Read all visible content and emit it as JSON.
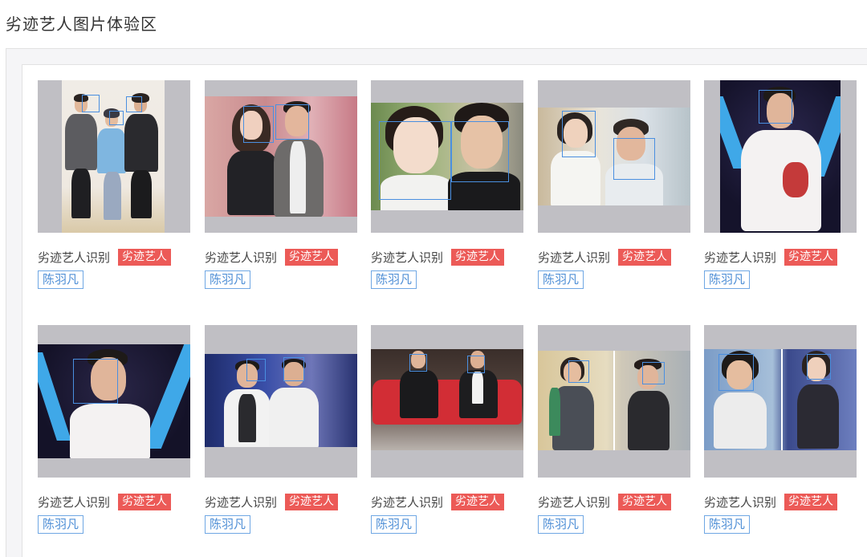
{
  "page": {
    "title": "劣迹艺人图片体验区"
  },
  "cards": [
    {
      "category": "劣迹艺人识别",
      "tag": "劣迹艺人",
      "name": "陈羽凡"
    },
    {
      "category": "劣迹艺人识别",
      "tag": "劣迹艺人",
      "name": "陈羽凡"
    },
    {
      "category": "劣迹艺人识别",
      "tag": "劣迹艺人",
      "name": "陈羽凡"
    },
    {
      "category": "劣迹艺人识别",
      "tag": "劣迹艺人",
      "name": "陈羽凡"
    },
    {
      "category": "劣迹艺人识别",
      "tag": "劣迹艺人",
      "name": "陈羽凡"
    },
    {
      "category": "劣迹艺人识别",
      "tag": "劣迹艺人",
      "name": "陈羽凡"
    },
    {
      "category": "劣迹艺人识别",
      "tag": "劣迹艺人",
      "name": "陈羽凡"
    },
    {
      "category": "劣迹艺人识别",
      "tag": "劣迹艺人",
      "name": "陈羽凡"
    },
    {
      "category": "劣迹艺人识别",
      "tag": "劣迹艺人",
      "name": "陈羽凡"
    },
    {
      "category": "劣迹艺人识别",
      "tag": "劣迹艺人",
      "name": "陈羽凡"
    }
  ],
  "colors": {
    "tag_red": "#ec5a57",
    "name_blue": "#4f8fd6",
    "face_box_blue": "#4a8fe0",
    "thumb_bg": "#c0bfc4"
  }
}
